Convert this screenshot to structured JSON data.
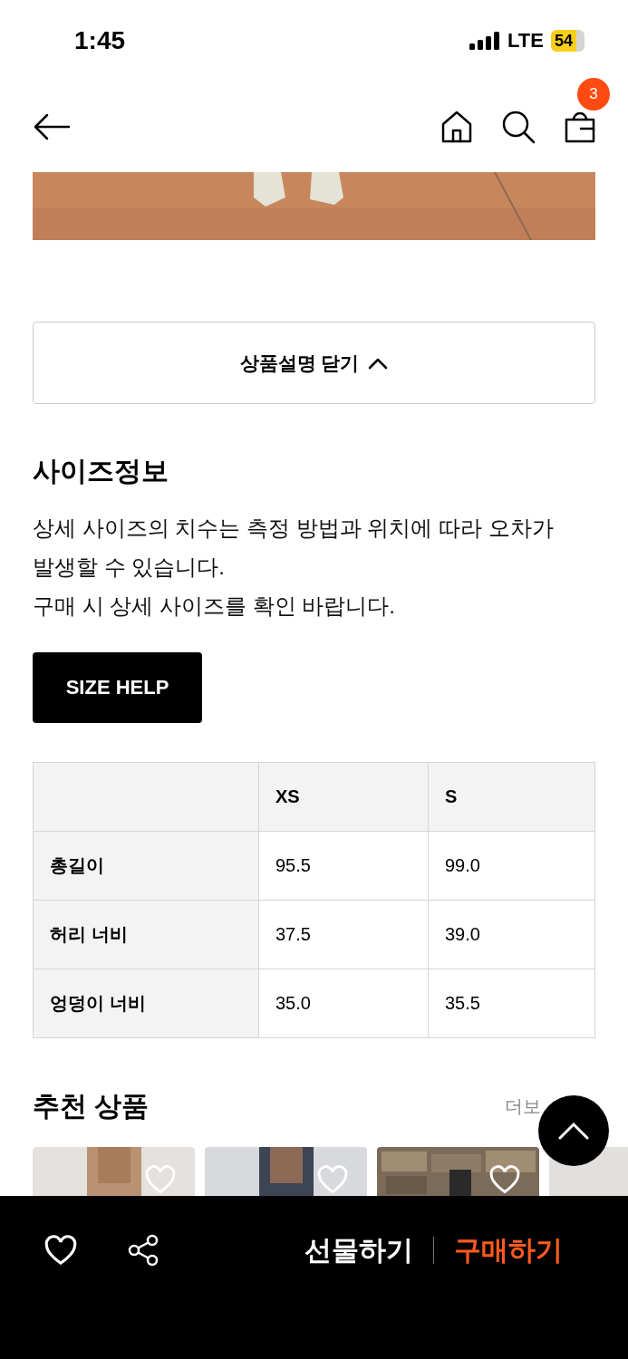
{
  "status_bar": {
    "time": "1:45",
    "network": "LTE",
    "battery": "54"
  },
  "nav": {
    "cart_count": "3"
  },
  "description_toggle": {
    "label": "상품설명 닫기",
    "expanded": true
  },
  "size_info": {
    "title": "사이즈정보",
    "notice": "상세 사이즈의 치수는 측정 방법과 위치에 따라 오차가 발생할 수 있습니다.\n구매 시 상세 사이즈를 확인 바랍니다.",
    "help_button": "SIZE HELP"
  },
  "size_table": {
    "columns": [
      "XS",
      "S"
    ],
    "rows": [
      {
        "label": "총길이",
        "values": [
          "95.5",
          "99.0"
        ]
      },
      {
        "label": "허리 너비",
        "values": [
          "37.5",
          "39.0"
        ]
      },
      {
        "label": "엉덩이 너비",
        "values": [
          "35.0",
          "35.5"
        ]
      }
    ]
  },
  "recommended": {
    "title": "추천 상품",
    "more": "더보"
  },
  "bottom_bar": {
    "gift": "선물하기",
    "buy": "구매하기"
  }
}
